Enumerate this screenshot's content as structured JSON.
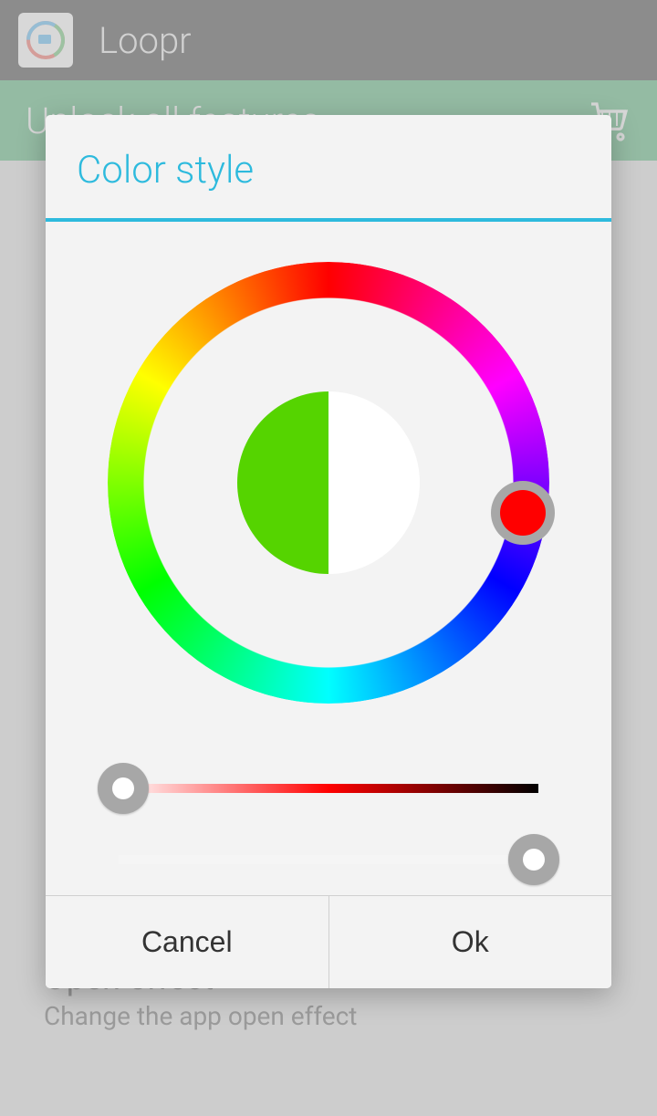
{
  "header": {
    "app_name": "Loopr"
  },
  "banner": {
    "text": "Unlock all features",
    "cart_icon": "shopping-cart-icon"
  },
  "settings_behind": {
    "open_effect": {
      "title": "Open effect",
      "subtitle": "Change the app open effect"
    }
  },
  "dialog": {
    "title": "Color style",
    "preview": {
      "old_color_hex": "#55d400",
      "new_color_hex": "#ffffff"
    },
    "hue_selector": {
      "angle_deg": 350,
      "thumb_color_hex": "#ff0000"
    },
    "sliders": {
      "saturation": {
        "value_pct": 0,
        "gradient_from": "#ffffff",
        "gradient_mid": "#ff0000",
        "gradient_to": "#000000"
      },
      "lightness": {
        "value_pct": 100,
        "gradient_from": "#ffffff",
        "gradient_to": "#ffffff"
      }
    },
    "buttons": {
      "cancel": "Cancel",
      "ok": "Ok"
    }
  },
  "colors": {
    "accent": "#2dbadd",
    "banner_bg": "#1d9e4e"
  }
}
